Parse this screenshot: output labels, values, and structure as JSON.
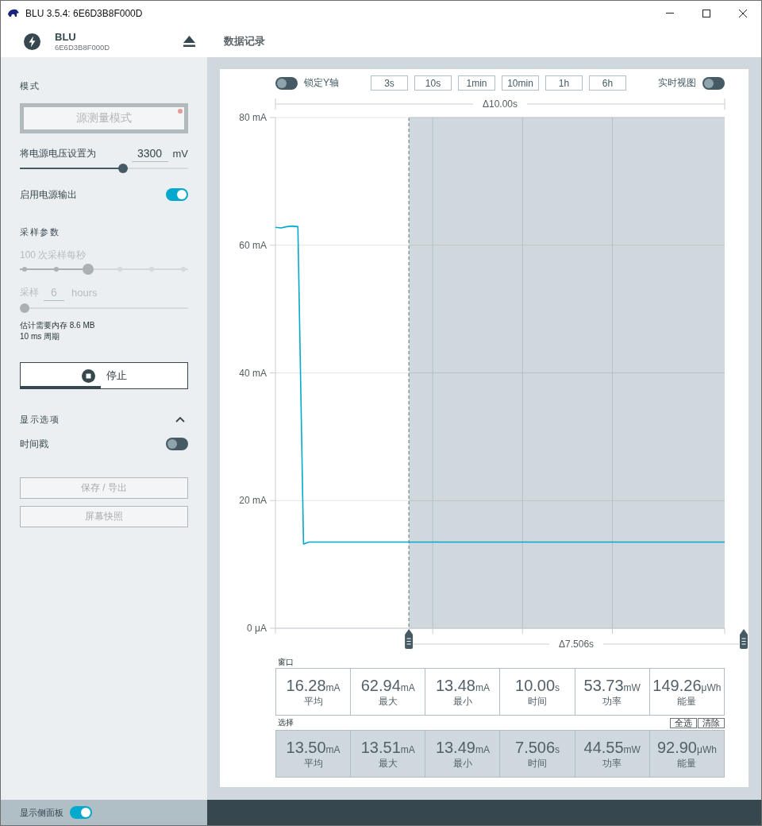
{
  "window": {
    "title": "BLU 3.5.4: 6E6D3B8F000D"
  },
  "header": {
    "device_name": "BLU",
    "device_serial": "6E6D3B8F000D",
    "page_title": "数据记录"
  },
  "sidebar": {
    "mode": {
      "heading": "模式",
      "button": {
        "label": "源测量模式",
        "disabled": true
      }
    },
    "voltage": {
      "label": "将电源电压设置为",
      "value": "3300",
      "unit": "mV",
      "level": 0.62
    },
    "power_output": {
      "label": "启用电源输出",
      "on": true
    },
    "sampling": {
      "heading": "采样参数",
      "rate": {
        "label": "100 次采样每秒",
        "disabled": true,
        "level": 0.4
      },
      "duration": {
        "label": "采样",
        "value": "6",
        "unit": "hours",
        "disabled": true,
        "level": 0
      },
      "memory_estimate": "估计需要内存 8.6 MB",
      "period": "10 ms 周期"
    },
    "stop_button": {
      "label": "停止",
      "level": 0.48
    },
    "display_options": {
      "heading": "显示选项",
      "expanded": true,
      "timestamp": {
        "label": "时间戳",
        "on": false
      }
    },
    "actions": [
      {
        "label": "保存 / 导出",
        "disabled": true
      },
      {
        "label": "屏幕快照",
        "disabled": true
      }
    ]
  },
  "toolbar": {
    "lock_y_axis": {
      "label": "锁定Y轴",
      "on": false
    },
    "time_windows": [
      {
        "label": "3s",
        "selected": false
      },
      {
        "label": "10s",
        "selected": false
      },
      {
        "label": "1min",
        "selected": false
      },
      {
        "label": "10min",
        "selected": false
      },
      {
        "label": "1h",
        "selected": false
      },
      {
        "label": "6h",
        "selected": false
      }
    ],
    "live_view": {
      "label": "实时视图",
      "on": false
    }
  },
  "chart": {
    "span_label": "Δ10.00s",
    "selection_label": "Δ7.506s",
    "chart_data": {
      "type": "line",
      "categories": [
        null,
        null,
        null,
        null,
        null,
        null,
        null,
        null,
        null,
        null,
        null,
        null,
        null,
        null,
        null,
        null,
        null,
        null,
        null,
        null,
        null,
        null,
        null,
        null,
        null,
        null,
        null,
        null,
        null,
        null,
        null,
        null,
        null,
        null,
        null,
        null,
        null,
        null,
        null,
        null,
        null,
        null,
        null,
        null,
        null,
        null,
        null,
        null,
        null,
        null,
        null,
        null,
        null,
        null,
        null,
        null,
        null,
        null,
        null,
        null,
        null,
        null,
        null,
        null,
        null,
        null,
        null,
        null,
        null,
        null,
        null,
        null,
        null,
        null,
        null,
        null,
        null,
        null,
        null,
        null,
        null
      ],
      "series": [
        {
          "color": "#00a9ce",
          "values": [
            62.8,
            62.7,
            62.9,
            63.0,
            62.9,
            13.2,
            13.5,
            13.5,
            13.5,
            13.5,
            13.5,
            13.5,
            13.5,
            13.5,
            13.5,
            13.5,
            13.5,
            13.5,
            13.5,
            13.5,
            13.5,
            13.5,
            13.5,
            13.5,
            13.5,
            13.5,
            13.5,
            13.5,
            13.5,
            13.5,
            13.5,
            13.5,
            13.5,
            13.5,
            13.5,
            13.5,
            13.5,
            13.5,
            13.5,
            13.5,
            13.5,
            13.5,
            13.5,
            13.5,
            13.5,
            13.5,
            13.5,
            13.5,
            13.5,
            13.5,
            13.5,
            13.5,
            13.5,
            13.5,
            13.5,
            13.5,
            13.5,
            13.5,
            13.5,
            13.5,
            13.5,
            13.5,
            13.5,
            13.5,
            13.5,
            13.5,
            13.5,
            13.5,
            13.5,
            13.5,
            13.5,
            13.5,
            13.5,
            13.5,
            13.5,
            13.5,
            13.5,
            13.5,
            13.5,
            13.5,
            13.5
          ]
        }
      ],
      "ylim": [
        0,
        80
      ],
      "yticks": [
        {
          "value": 0,
          "label": "0 μA"
        },
        {
          "value": 20,
          "label": "20 mA"
        },
        {
          "value": 40,
          "label": "40 mA"
        },
        {
          "value": 60,
          "label": "60 mA"
        },
        {
          "value": 80,
          "label": "80 mA"
        }
      ],
      "grid": true
    }
  },
  "window_stats": {
    "heading": "窗口",
    "cells": [
      {
        "value": "16.28",
        "unit": "mA",
        "label": "平均"
      },
      {
        "value": "62.94",
        "unit": "mA",
        "label": "最大"
      },
      {
        "value": "13.48",
        "unit": "mA",
        "label": "最小"
      },
      {
        "value": "10.00",
        "unit": "s",
        "label": "时间"
      },
      {
        "value": "53.73",
        "unit": "mW",
        "label": "功率"
      },
      {
        "value": "149.26",
        "unit": "μWh",
        "label": "能量"
      }
    ]
  },
  "selection_stats": {
    "heading": "选择",
    "buttons": [
      {
        "label": "全选"
      },
      {
        "label": "清除"
      }
    ],
    "cells": [
      {
        "value": "13.50",
        "unit": "mA",
        "label": "平均"
      },
      {
        "value": "13.51",
        "unit": "mA",
        "label": "最大"
      },
      {
        "value": "13.49",
        "unit": "mA",
        "label": "最小"
      },
      {
        "value": "7.506",
        "unit": "s",
        "label": "时间"
      },
      {
        "value": "44.55",
        "unit": "mW",
        "label": "功率"
      },
      {
        "value": "92.90",
        "unit": "μWh",
        "label": "能量"
      }
    ]
  },
  "status_bar": {
    "sidebar_toggle": {
      "label": "显示侧面板",
      "on": true
    }
  }
}
